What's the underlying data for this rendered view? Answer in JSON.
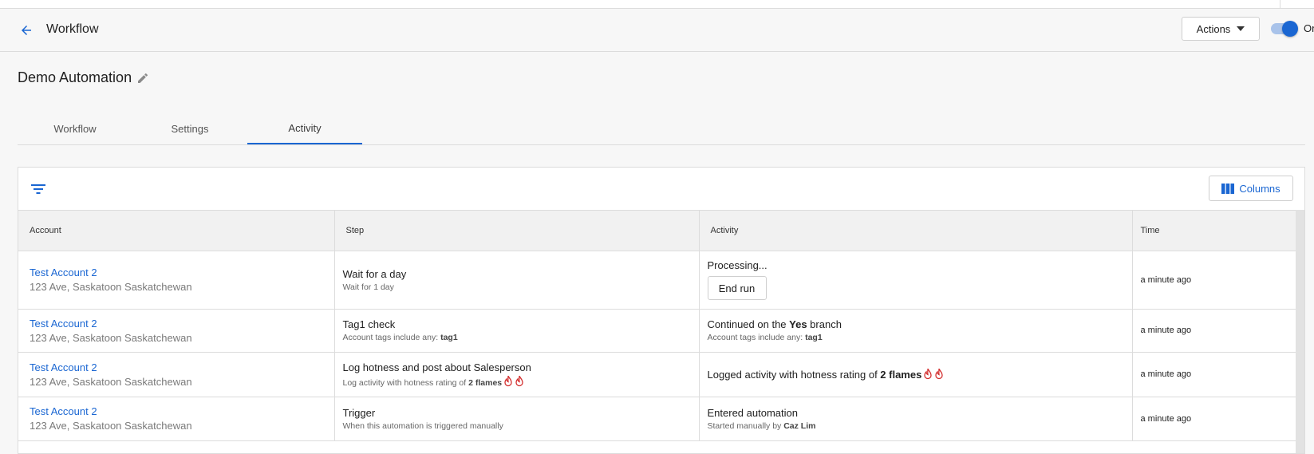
{
  "header": {
    "title": "Workflow",
    "actions_label": "Actions",
    "toggle_label": "On",
    "toggle_on": true
  },
  "page": {
    "title": "Demo Automation"
  },
  "tabs": [
    {
      "label": "Workflow",
      "active": false
    },
    {
      "label": "Settings",
      "active": false
    },
    {
      "label": "Activity",
      "active": true
    }
  ],
  "toolbar": {
    "columns_label": "Columns"
  },
  "table": {
    "columns": [
      "Account",
      "Step",
      "Activity",
      "Time"
    ],
    "rows": [
      {
        "account": "Test Account 2",
        "address": "123 Ave, Saskatoon Saskatchewan",
        "step_title": "Wait for a day",
        "step_detail": "Wait for 1 day",
        "activity_title": "Processing...",
        "activity_button": "End run",
        "time": "a minute ago"
      },
      {
        "account": "Test Account 2",
        "address": "123 Ave, Saskatoon Saskatchewan",
        "step_title": "Tag1 check",
        "step_detail_prefix": "Account tags include any: ",
        "step_detail_bold": "tag1",
        "activity_prefix": "Continued on the ",
        "activity_bold": "Yes",
        "activity_suffix": " branch",
        "activity_detail_prefix": "Account tags include any: ",
        "activity_detail_bold": "tag1",
        "time": "a minute ago"
      },
      {
        "account": "Test Account 2",
        "address": "123 Ave, Saskatoon Saskatchewan",
        "step_title": "Log hotness and post about Salesperson",
        "step_detail_prefix": "Log activity with hotness rating of ",
        "step_detail_bold": "2 flames",
        "activity_prefix": "Logged activity with hotness rating of ",
        "activity_bold": "2 flames",
        "time": "a minute ago"
      },
      {
        "account": "Test Account 2",
        "address": "123 Ave, Saskatoon Saskatchewan",
        "step_title": "Trigger",
        "step_detail": "When this automation is triggered manually",
        "activity_title": "Entered automation",
        "activity_detail_prefix": "Started manually by ",
        "activity_detail_bold": "Caz Lim",
        "time": "a minute ago"
      }
    ]
  },
  "colors": {
    "accent": "#1a66d2",
    "flame": "#d32f2f"
  }
}
